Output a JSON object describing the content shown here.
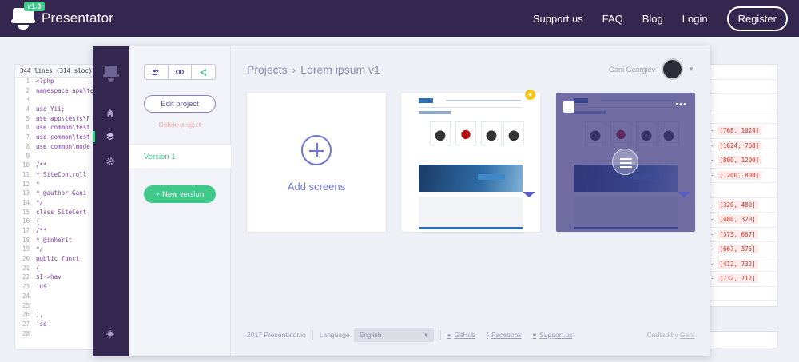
{
  "topnav": {
    "version": "v1.0",
    "brand": "Presentator",
    "links": [
      "Support us",
      "FAQ",
      "Blog",
      "Login"
    ],
    "register": "Register"
  },
  "code": {
    "header": "344 lines (314 sloc)",
    "lines": [
      {
        "n": "1",
        "t": "<?php"
      },
      {
        "n": "2",
        "t": "namespace app\\te"
      },
      {
        "n": "3",
        "t": ""
      },
      {
        "n": "4",
        "t": "use Yii;"
      },
      {
        "n": "5",
        "t": "use app\\tests\\F"
      },
      {
        "n": "6",
        "t": "use common\\test"
      },
      {
        "n": "7",
        "t": "use common\\test"
      },
      {
        "n": "8",
        "t": "use common\\mode"
      },
      {
        "n": "9",
        "t": ""
      },
      {
        "n": "10",
        "t": "/**"
      },
      {
        "n": "11",
        "t": " * SiteControll"
      },
      {
        "n": "12",
        "t": " *"
      },
      {
        "n": "13",
        "t": " * @author Gani"
      },
      {
        "n": "14",
        "t": " */"
      },
      {
        "n": "15",
        "t": "class SiteCest"
      },
      {
        "n": "16",
        "t": "{"
      },
      {
        "n": "17",
        "t": "    /**"
      },
      {
        "n": "18",
        "t": "     * @inherit"
      },
      {
        "n": "19",
        "t": "     */"
      },
      {
        "n": "20",
        "t": "    public funct"
      },
      {
        "n": "21",
        "t": "    {"
      },
      {
        "n": "22",
        "t": "        $I->hav"
      },
      {
        "n": "23",
        "t": "            'us"
      },
      {
        "n": "24",
        "t": ""
      },
      {
        "n": "25",
        "t": ""
      },
      {
        "n": "26",
        "t": "        ],"
      },
      {
        "n": "27",
        "t": "        'se"
      },
      {
        "n": "28",
        "t": ""
      }
    ]
  },
  "right_table": {
    "rows": [
      {
        "dash": "",
        "val": ""
      },
      {
        "dash": "",
        "val": ""
      },
      {
        "dash": "",
        "val": ""
      },
      {
        "dash": "",
        "val": ""
      },
      {
        "dash": "-",
        "val": "[768, 1024]"
      },
      {
        "dash": "-",
        "val": "[1024, 768]"
      },
      {
        "dash": "-",
        "val": "[800, 1200]"
      },
      {
        "dash": "-",
        "val": "[1200, 800]"
      },
      {
        "dash": "",
        "val": ""
      },
      {
        "dash": "-",
        "val": "[320, 480]"
      },
      {
        "dash": "-",
        "val": "[480, 320]"
      },
      {
        "dash": "-",
        "val": "[375, 667]"
      },
      {
        "dash": "-",
        "val": "[667, 375]"
      },
      {
        "dash": "-",
        "val": "[412, 732]"
      },
      {
        "dash": "-",
        "val": "[732, 712]"
      },
      {
        "dash": "",
        "val": ""
      }
    ]
  },
  "sidebar": {
    "icons": [
      "home-icon",
      "layers-icon",
      "gear-icon",
      "bug-icon"
    ]
  },
  "project_panel": {
    "edit_label": "Edit project",
    "delete_label": "Delete project",
    "version_label": "Version 1",
    "new_version_label": "+ New version"
  },
  "main": {
    "breadcrumb_root": "Projects",
    "breadcrumb_sep": "›",
    "breadcrumb_current": "Lorem ipsum v1",
    "user_name": "Gani Georgiev",
    "add_screens_label": "Add screens",
    "footer": {
      "copyright": "2017 Presentator.io",
      "language_label": "Language",
      "language_value": "English",
      "github": "GitHub",
      "facebook": "Facebook",
      "support": "Support us",
      "crafted_prefix": "Crafted by",
      "crafted_author": "Gani"
    }
  },
  "colors": {
    "nav_bg": "#33264f",
    "accent_green": "#3fc98b",
    "accent_blue": "#6c74d9",
    "overlay": "#3a3480",
    "star": "#f5c515"
  }
}
